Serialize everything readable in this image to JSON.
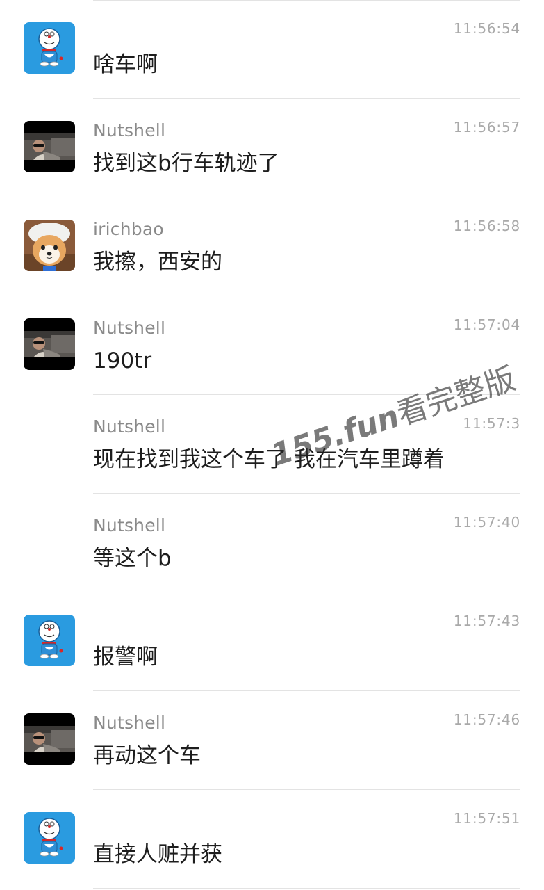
{
  "messages": [
    {
      "avatar": "doraemon-avatar",
      "sender": "",
      "time": "11:56:54",
      "text": "啥车啊"
    },
    {
      "avatar": "sunglasses-man-avatar",
      "sender": "Nutshell",
      "time": "11:56:57",
      "text": "找到这b行车轨迹了"
    },
    {
      "avatar": "shiba-dog-avatar",
      "sender": "irichbao",
      "time": "11:56:58",
      "text": "我擦，西安的"
    },
    {
      "avatar": "sunglasses-man-avatar",
      "sender": "Nutshell",
      "time": "11:57:04",
      "text": "190tr"
    },
    {
      "avatar": "",
      "sender": "Nutshell",
      "time": "11:57:3",
      "text": "现在找到我这个车了 我在汽车里蹲着"
    },
    {
      "avatar": "",
      "sender": "Nutshell",
      "time": "11:57:40",
      "text": "等这个b"
    },
    {
      "avatar": "doraemon-avatar",
      "sender": "",
      "time": "11:57:43",
      "text": "报警啊"
    },
    {
      "avatar": "sunglasses-man-avatar",
      "sender": "Nutshell",
      "time": "11:57:46",
      "text": "再动这个车"
    },
    {
      "avatar": "doraemon-avatar",
      "sender": "",
      "time": "11:57:51",
      "text": "直接人赃并获"
    }
  ],
  "watermark": {
    "url": "155.fun",
    "text": "看完整版"
  },
  "colors": {
    "divider": "#e3e3e3",
    "sender": "#8a8a8a",
    "time": "#a9a9a9",
    "text": "#1d1d1d",
    "doraemon_blue": "#2a9be0"
  }
}
